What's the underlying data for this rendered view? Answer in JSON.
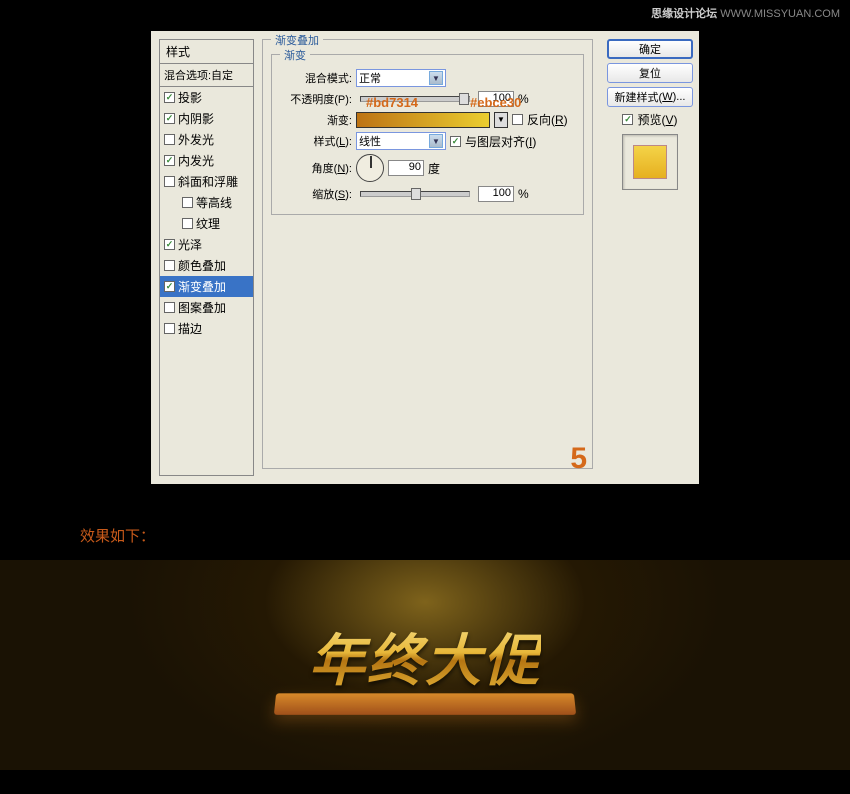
{
  "watermark": {
    "site": "思缘设计论坛",
    "url": "WWW.MISSYUAN.COM"
  },
  "sidebar": {
    "title": "样式",
    "blend_options": "混合选项:自定",
    "items": [
      {
        "label": "投影",
        "checked": true
      },
      {
        "label": "内阴影",
        "checked": true
      },
      {
        "label": "外发光",
        "checked": false
      },
      {
        "label": "内发光",
        "checked": true
      },
      {
        "label": "斜面和浮雕",
        "checked": false
      },
      {
        "label": "等高线",
        "checked": false,
        "indent": true
      },
      {
        "label": "纹理",
        "checked": false,
        "indent": true
      },
      {
        "label": "光泽",
        "checked": true
      },
      {
        "label": "颜色叠加",
        "checked": false
      },
      {
        "label": "渐变叠加",
        "checked": true,
        "active": true
      },
      {
        "label": "图案叠加",
        "checked": false
      },
      {
        "label": "描边",
        "checked": false
      }
    ]
  },
  "panel": {
    "title": "渐变叠加",
    "subtitle": "渐变",
    "blend_mode_label": "混合模式:",
    "blend_mode_value": "正常",
    "opacity_label": "不透明度(P):",
    "opacity_value": "100",
    "opacity_unit": "%",
    "gradient_label": "渐变:",
    "reverse_label": "反向(R)",
    "style_label": "样式(L):",
    "style_value": "线性",
    "align_label": "与图层对齐(I)",
    "angle_label": "角度(N):",
    "angle_value": "90",
    "angle_unit": "度",
    "scale_label": "缩放(S):",
    "scale_value": "100",
    "scale_unit": "%",
    "color1": "#bd7314",
    "color2": "#ebce30"
  },
  "buttons": {
    "ok": "确定",
    "reset": "复位",
    "new_style": "新建样式(W)...",
    "preview": "预览(V)"
  },
  "step": "5",
  "result_label": "效果如下：",
  "banner_text": "年终大促"
}
